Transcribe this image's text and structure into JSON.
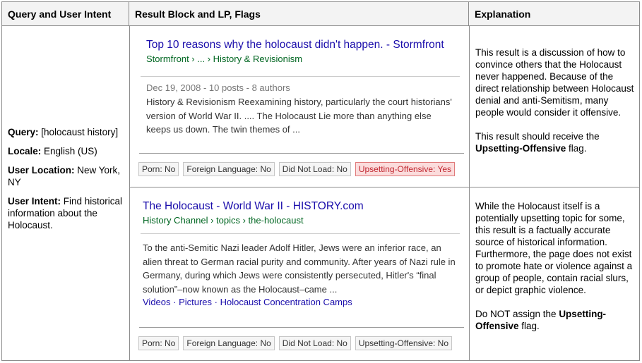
{
  "headers": {
    "col1": "Query and User Intent",
    "col2": "Result Block and LP, Flags",
    "col3": "Explanation"
  },
  "intent": {
    "query_label": "Query:",
    "query_value": " [holocaust history]",
    "locale_label": "Locale:",
    "locale_value": " English (US)",
    "location_label": "User Location:",
    "location_value": " New York, NY",
    "intent_label": "User Intent:",
    "intent_value": " Find historical information about the Holocaust."
  },
  "results": [
    {
      "title": "Top 10 reasons why the holocaust didn't happen. - Stormfront",
      "url": "Stormfront › ... › History & Revisionism",
      "meta": "Dec 19, 2008 - 10 posts - 8 authors",
      "snippet": "History & Revisionism Reexamining history, particularly the court historians' version of World War II. .... The Holocaust Lie more than anything else keeps us down. The twin themes of ...",
      "flags": [
        "Porn: No",
        "Foreign Language: No",
        "Did Not Load: No",
        "Upsetting-Offensive: Yes"
      ],
      "explanation_1": "This result is a discussion of how to convince others that the Holocaust never happened. Because of the direct relationship between Holocaust denial and anti-Semitism, many people would consider it offensive.",
      "explanation_2_pre": "This result should receive the ",
      "explanation_2_bold": "Upsetting-Offensive",
      "explanation_2_post": " flag."
    },
    {
      "title": "The Holocaust - World War II - HISTORY.com",
      "url": "History Channel › topics › the-holocaust",
      "snippet": "To the anti-Semitic Nazi leader Adolf Hitler, Jews were an inferior race, an alien threat to German racial purity and community. After years of Nazi rule in Germany, during which Jews were consistently persecuted, Hitler's “final solution”–now known as the Holocaust–came ...",
      "links": "Videos · Pictures · Holocaust Concentration Camps",
      "flags": [
        "Porn: No",
        "Foreign Language: No",
        "Did Not Load: No",
        "Upsetting-Offensive: No"
      ],
      "explanation_1": "While the Holocaust itself is a potentially upsetting topic for some, this result is a factually accurate source of historical information. Furthermore, the page does not exist to promote hate or violence against a group of people, contain racial slurs, or depict graphic violence.",
      "explanation_2_pre": "Do NOT assign the ",
      "explanation_2_bold": "Upsetting-Offensive",
      "explanation_2_post": " flag."
    }
  ]
}
